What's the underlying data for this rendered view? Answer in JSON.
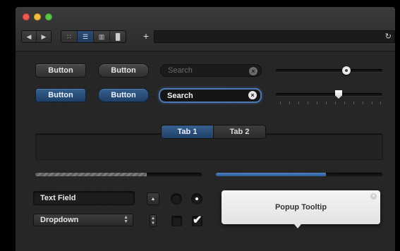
{
  "window": {
    "traffic_lights": [
      "close",
      "minimize",
      "zoom"
    ]
  },
  "toolbar": {
    "nav": {
      "back_icon": "◀",
      "forward_icon": "▶"
    },
    "view_modes": [
      {
        "name": "grid-view",
        "glyph": "∷",
        "active": false
      },
      {
        "name": "list-view",
        "glyph": "☰",
        "active": true
      },
      {
        "name": "column-view",
        "glyph": "▥",
        "active": false
      },
      {
        "name": "coverflow-view",
        "glyph": "▐▌",
        "active": false
      }
    ],
    "add_glyph": "+",
    "reload_glyph": "↻"
  },
  "buttons": {
    "row1_rect": "Button",
    "row1_pill": "Button",
    "row2_rect": "Button",
    "row2_pill": "Button"
  },
  "search": {
    "inactive_placeholder": "Search",
    "active_value": "Search",
    "clear_glyph": "×"
  },
  "sliders": {
    "round_knob_value": 0.66,
    "pointer_knob_value": 0.57,
    "tick_count": 12
  },
  "tabs": {
    "items": [
      {
        "label": "Tab 1",
        "active": true
      },
      {
        "label": "Tab 2",
        "active": false
      }
    ]
  },
  "progress": {
    "indeterminate_value": 0.67,
    "determinate_value": 0.66
  },
  "controls": {
    "text_field_value": "Text Field",
    "dropdown_value": "Dropdown",
    "arrow_up_glyph": "▲",
    "stepper_glyph": "▲\n▼",
    "radio_selected": [
      false,
      true
    ],
    "checkbox_checked": [
      false,
      true
    ],
    "checkmark_glyph": "✔"
  },
  "tooltip": {
    "text": "Popup Tooltip",
    "close_glyph": "×"
  },
  "colors": {
    "accent_blue": "#2c5b94",
    "window_bg": "#262626"
  }
}
